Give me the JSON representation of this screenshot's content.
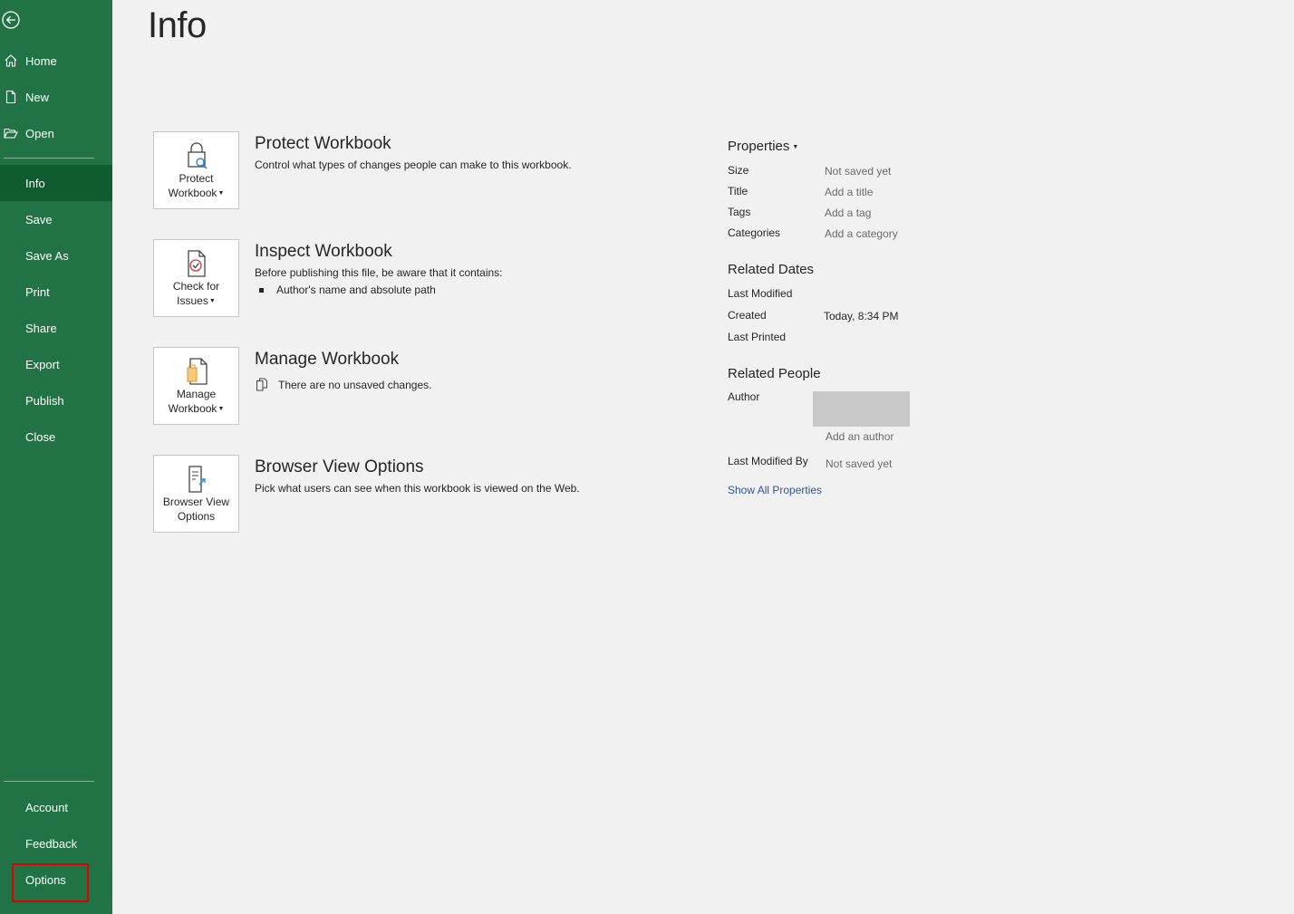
{
  "sidebar": {
    "items": [
      {
        "label": "Home",
        "icon": "home-icon"
      },
      {
        "label": "New",
        "icon": "new-document-icon"
      },
      {
        "label": "Open",
        "icon": "open-folder-icon"
      },
      {
        "label": "Info",
        "active": true
      },
      {
        "label": "Save"
      },
      {
        "label": "Save As"
      },
      {
        "label": "Print"
      },
      {
        "label": "Share"
      },
      {
        "label": "Export"
      },
      {
        "label": "Publish"
      },
      {
        "label": "Close"
      }
    ],
    "bottom_items": [
      {
        "label": "Account"
      },
      {
        "label": "Feedback"
      },
      {
        "label": "Options",
        "highlighted": true
      }
    ],
    "colors": {
      "background": "#217346",
      "active": "#0e5c2f",
      "highlight_border": "#e00000"
    }
  },
  "page": {
    "title": "Info"
  },
  "sections": [
    {
      "button_label_line1": "Protect",
      "button_label_line2": "Workbook",
      "title": "Protect Workbook",
      "description": "Control what types of changes people can make to this workbook."
    },
    {
      "button_label_line1": "Check for",
      "button_label_line2": "Issues",
      "title": "Inspect Workbook",
      "description": "Before publishing this file, be aware that it contains:",
      "bullets": [
        "Author's name and absolute path"
      ]
    },
    {
      "button_label_line1": "Manage",
      "button_label_line2": "Workbook",
      "title": "Manage Workbook",
      "description": "There are no unsaved changes."
    },
    {
      "button_label_line1": "Browser View",
      "button_label_line2": "Options",
      "title": "Browser View Options",
      "description": "Pick what users can see when this workbook is viewed on the Web."
    }
  ],
  "properties": {
    "heading": "Properties",
    "rows": [
      {
        "label": "Size",
        "value": "Not saved yet"
      },
      {
        "label": "Title",
        "value": "Add a title"
      },
      {
        "label": "Tags",
        "value": "Add a tag"
      },
      {
        "label": "Categories",
        "value": "Add a category"
      }
    ],
    "related_dates": {
      "heading": "Related Dates",
      "last_modified_label": "Last Modified",
      "created_label": "Created",
      "created_value": "Today, 8:34 PM",
      "last_printed_label": "Last Printed"
    },
    "related_people": {
      "heading": "Related People",
      "author_label": "Author",
      "add_author": "Add an author",
      "last_modified_by_label": "Last Modified By",
      "last_modified_by_value": "Not saved yet"
    },
    "show_all": "Show All Properties"
  }
}
